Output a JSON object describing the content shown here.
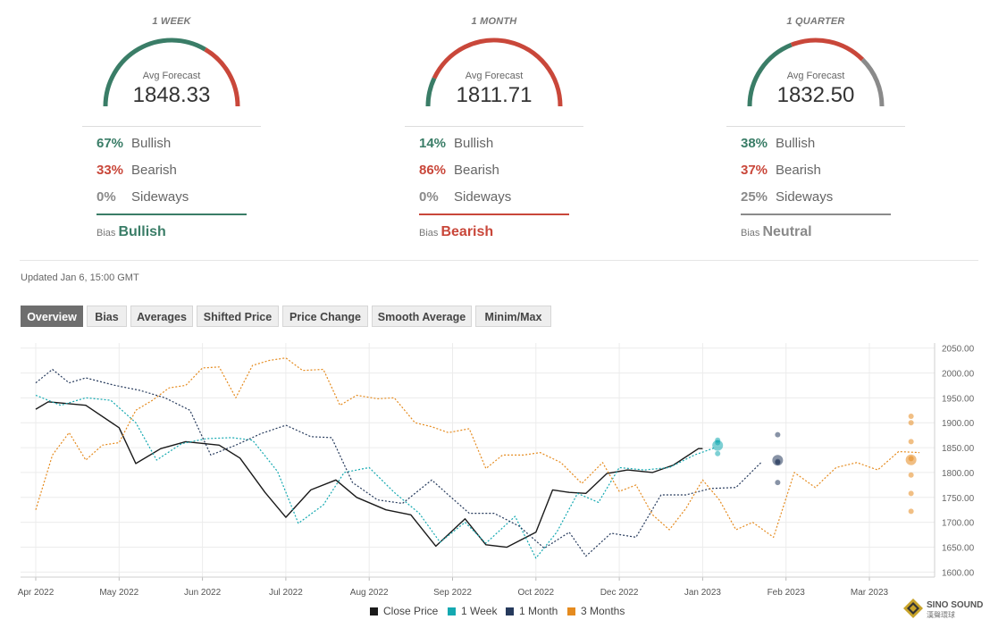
{
  "panels": [
    {
      "title": "1 WEEK",
      "avg_label": "Avg Forecast",
      "avg_value": "1848.33",
      "rows": [
        {
          "pct": "67%",
          "label": "Bullish"
        },
        {
          "pct": "33%",
          "label": "Bearish"
        },
        {
          "pct": "0%",
          "label": "Sideways"
        }
      ],
      "bias_label": "Bias",
      "bias_value": "Bullish",
      "bias_color": "#3a7d67",
      "gauge": [
        {
          "fraction": 0.67,
          "color": "#3a7d67"
        },
        {
          "fraction": 0.33,
          "color": "#c9473a"
        },
        {
          "fraction": 0.0,
          "color": "#8a8a8a"
        }
      ]
    },
    {
      "title": "1 MONTH",
      "avg_label": "Avg Forecast",
      "avg_value": "1811.71",
      "rows": [
        {
          "pct": "14%",
          "label": "Bullish"
        },
        {
          "pct": "86%",
          "label": "Bearish"
        },
        {
          "pct": "0%",
          "label": "Sideways"
        }
      ],
      "bias_label": "Bias",
      "bias_value": "Bearish",
      "bias_color": "#c9473a",
      "gauge": [
        {
          "fraction": 0.14,
          "color": "#3a7d67"
        },
        {
          "fraction": 0.86,
          "color": "#c9473a"
        },
        {
          "fraction": 0.0,
          "color": "#8a8a8a"
        }
      ]
    },
    {
      "title": "1 QUARTER",
      "avg_label": "Avg Forecast",
      "avg_value": "1832.50",
      "rows": [
        {
          "pct": "38%",
          "label": "Bullish"
        },
        {
          "pct": "37%",
          "label": "Bearish"
        },
        {
          "pct": "25%",
          "label": "Sideways"
        }
      ],
      "bias_label": "Bias",
      "bias_value": "Neutral",
      "bias_color": "#8a8a8a",
      "gauge": [
        {
          "fraction": 0.38,
          "color": "#3a7d67"
        },
        {
          "fraction": 0.37,
          "color": "#c9473a"
        },
        {
          "fraction": 0.25,
          "color": "#8a8a8a"
        }
      ]
    }
  ],
  "colors": {
    "bullish": "#3a7d67",
    "bearish": "#c9473a",
    "neutral": "#8a8a8a"
  },
  "updated": "Updated Jan 6, 15:00 GMT",
  "tabs": [
    {
      "label": "Overview",
      "active": true
    },
    {
      "label": "Bias",
      "active": false
    },
    {
      "label": "Averages",
      "active": false
    },
    {
      "label": "Shifted Price",
      "active": false
    },
    {
      "label": "Price Change",
      "active": false
    },
    {
      "label": "Smooth Average",
      "active": false
    },
    {
      "label": "Minim/Max",
      "active": false
    }
  ],
  "logo": {
    "text": "SINO SOUND",
    "subtext": "漢聲環球"
  },
  "chart_data": {
    "type": "line",
    "x_ticks": [
      "Apr 2022",
      "May 2022",
      "Jun 2022",
      "Jul 2022",
      "Aug 2022",
      "Sep 2022",
      "Oct 2022",
      "Dec 2022",
      "Jan 2023",
      "Feb 2023",
      "Mar 2023"
    ],
    "ylim": [
      1590,
      2060
    ],
    "y_ticks": [
      2050,
      2000,
      1950,
      1900,
      1850,
      1800,
      1750,
      1700,
      1650,
      1600
    ],
    "y_tick_labels": [
      "2050.00",
      "2000.00",
      "1950.00",
      "1900.00",
      "1850.00",
      "1800.00",
      "1750.00",
      "1700.00",
      "1650.00",
      "1600.00"
    ],
    "grid": true,
    "series": [
      {
        "name": "Close Price",
        "color": "#1a1a1a",
        "style": "solid",
        "x": [
          0,
          0.15,
          0.6,
          1.0,
          1.2,
          1.5,
          1.8,
          2.2,
          2.45,
          2.75,
          3.0,
          3.3,
          3.6,
          3.85,
          4.2,
          4.5,
          4.8,
          5.15,
          5.4,
          5.65,
          6.0,
          6.2,
          6.4,
          6.6,
          6.85,
          7.1,
          7.4,
          7.65,
          7.95,
          8.0
        ],
        "values": [
          1927,
          1942,
          1935,
          1890,
          1818,
          1848,
          1862,
          1855,
          1829,
          1760,
          1710,
          1765,
          1785,
          1750,
          1725,
          1715,
          1652,
          1707,
          1655,
          1650,
          1680,
          1765,
          1760,
          1758,
          1798,
          1805,
          1800,
          1815,
          1848,
          1848
        ]
      },
      {
        "name": "1 Week",
        "color": "#14a9b1",
        "style": "dotted",
        "x": [
          0,
          0.3,
          0.6,
          0.9,
          1.2,
          1.45,
          1.75,
          2.05,
          2.35,
          2.6,
          2.9,
          3.15,
          3.45,
          3.7,
          4.0,
          4.3,
          4.6,
          4.85,
          5.15,
          5.4,
          5.75,
          6.0,
          6.25,
          6.5,
          6.75,
          7.0,
          7.3,
          7.6,
          7.9,
          8.15
        ],
        "values": [
          1955,
          1935,
          1950,
          1945,
          1900,
          1825,
          1858,
          1868,
          1870,
          1865,
          1802,
          1698,
          1735,
          1800,
          1810,
          1760,
          1718,
          1660,
          1700,
          1658,
          1712,
          1628,
          1680,
          1758,
          1740,
          1810,
          1805,
          1810,
          1835,
          1850
        ]
      },
      {
        "name": "1 Month",
        "color": "#263a5c",
        "style": "dotted",
        "x": [
          0,
          0.2,
          0.4,
          0.6,
          0.95,
          1.25,
          1.55,
          1.85,
          2.1,
          2.4,
          2.7,
          3.0,
          3.3,
          3.55,
          3.8,
          4.1,
          4.4,
          4.75,
          4.95,
          5.2,
          5.5,
          5.8,
          6.1,
          6.4,
          6.6,
          6.9,
          7.2,
          7.5,
          7.8,
          8.1,
          8.4,
          8.7
        ],
        "values": [
          1980,
          2007,
          1980,
          1990,
          1975,
          1965,
          1950,
          1925,
          1835,
          1855,
          1878,
          1895,
          1872,
          1870,
          1780,
          1745,
          1738,
          1785,
          1755,
          1718,
          1718,
          1692,
          1648,
          1680,
          1632,
          1678,
          1670,
          1755,
          1755,
          1768,
          1770,
          1820
        ]
      },
      {
        "name": "3 Months",
        "color": "#e58b1f",
        "style": "dotted",
        "x": [
          0,
          0.2,
          0.4,
          0.6,
          0.8,
          1.0,
          1.2,
          1.4,
          1.6,
          1.8,
          2.0,
          2.2,
          2.4,
          2.6,
          2.8,
          3.0,
          3.2,
          3.45,
          3.65,
          3.85,
          4.1,
          4.3,
          4.55,
          4.75,
          4.95,
          5.2,
          5.4,
          5.6,
          5.85,
          6.05,
          6.3,
          6.55,
          6.8,
          7.0,
          7.2,
          7.4,
          7.6,
          7.8,
          8.0,
          8.2,
          8.4,
          8.6,
          8.85,
          9.1,
          9.35,
          9.6,
          9.85,
          10.1,
          10.35,
          10.6
        ],
        "values": [
          1725,
          1835,
          1880,
          1825,
          1855,
          1860,
          1925,
          1945,
          1970,
          1975,
          2010,
          2012,
          1950,
          2015,
          2025,
          2030,
          2005,
          2007,
          1935,
          1955,
          1948,
          1950,
          1900,
          1892,
          1880,
          1888,
          1808,
          1835,
          1835,
          1840,
          1820,
          1778,
          1820,
          1762,
          1775,
          1715,
          1685,
          1728,
          1785,
          1745,
          1685,
          1700,
          1670,
          1800,
          1770,
          1810,
          1820,
          1805,
          1842,
          1840
        ]
      }
    ],
    "forecast_dots": [
      {
        "series": "1 Week",
        "x": 8.18,
        "values": [
          1865,
          1860,
          1838
        ]
      },
      {
        "series": "1 Month",
        "x": 8.9,
        "values": [
          1876,
          1822,
          1820,
          1780
        ]
      },
      {
        "series": "3 Months",
        "x": 10.5,
        "values": [
          1913,
          1900,
          1862,
          1828,
          1795,
          1758,
          1722
        ]
      }
    ]
  },
  "legend": [
    {
      "label": "Close Price",
      "color": "#1a1a1a"
    },
    {
      "label": "1 Week",
      "color": "#14a9b1"
    },
    {
      "label": "1 Month",
      "color": "#263a5c"
    },
    {
      "label": "3 Months",
      "color": "#e58b1f"
    }
  ]
}
